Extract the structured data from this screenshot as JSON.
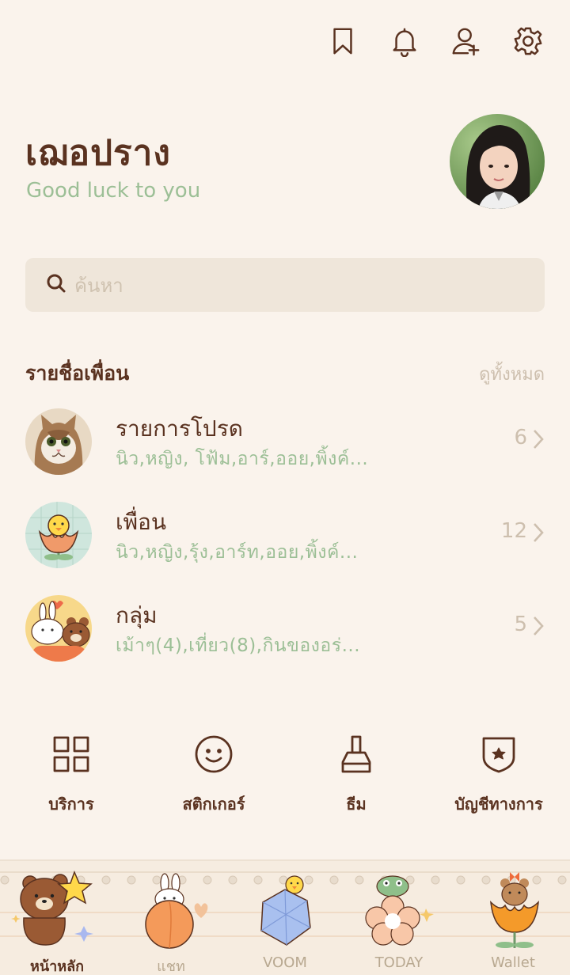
{
  "header": {
    "icons": [
      "bookmark-icon",
      "bell-icon",
      "add-friend-icon",
      "gear-icon"
    ]
  },
  "profile": {
    "name": "เฌอปราง",
    "status_message": "Good luck to you"
  },
  "search": {
    "placeholder": "ค้นหา"
  },
  "friends_section": {
    "title": "รายชื่อเพื่อน",
    "see_all": "ดูทั้งหมด",
    "items": [
      {
        "title": "รายการโปรด",
        "subtitle": "นิว,หญิง, โฟ้ม,อาร์,ออย,พิ้งค์...",
        "count": "6"
      },
      {
        "title": "เพื่อน",
        "subtitle": "นิว,หญิง,รุ้ง,อาร์ท,ออย,พิ้งค์...",
        "count": "12"
      },
      {
        "title": "กลุ่ม",
        "subtitle": "เม้าๆ(4),เที่ยว(8),กินของอร่...",
        "count": "5"
      }
    ]
  },
  "services": [
    {
      "label": "บริการ",
      "icon": "grid-icon"
    },
    {
      "label": "สติกเกอร์",
      "icon": "smiley-icon"
    },
    {
      "label": "ธีม",
      "icon": "brush-icon"
    },
    {
      "label": "บัญชีทางการ",
      "icon": "shield-star-icon"
    }
  ],
  "tabbar": {
    "active": "home",
    "tabs": [
      {
        "key": "home",
        "label": "หน้าหลัก"
      },
      {
        "key": "chat",
        "label": "แชท"
      },
      {
        "key": "voom",
        "label": "VOOM"
      },
      {
        "key": "today",
        "label": "TODAY"
      },
      {
        "key": "wallet",
        "label": "Wallet"
      }
    ]
  },
  "colors": {
    "background": "#faf3ec",
    "primary_text": "#5a3220",
    "accent_green": "#9cbf96",
    "muted": "#cdbfae",
    "search_bg": "#efe6da"
  }
}
